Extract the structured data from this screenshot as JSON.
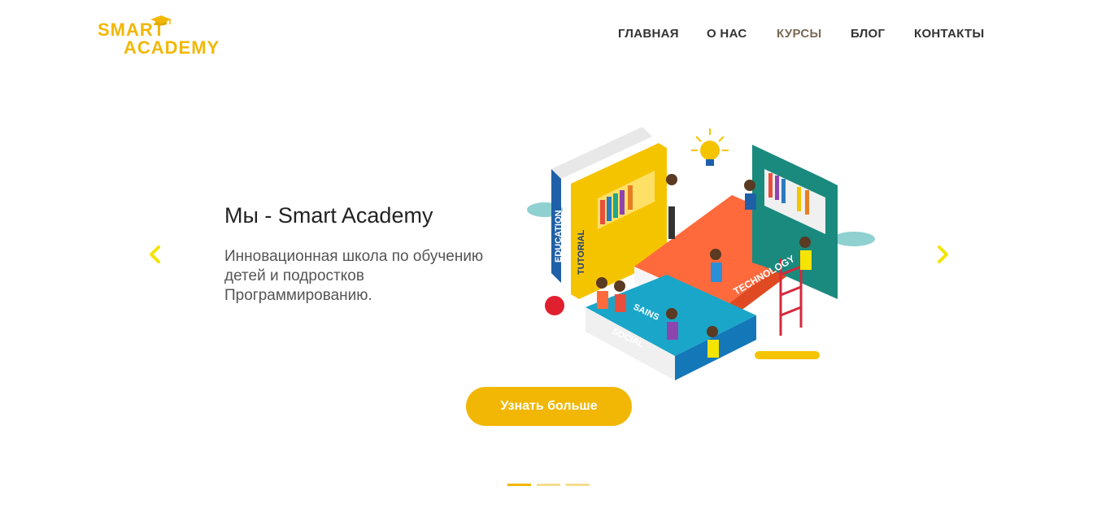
{
  "header": {
    "logo": {
      "line1": "SMART",
      "line2": "ACADEMY",
      "icon": "graduation-cap-icon"
    },
    "nav": [
      {
        "label": "ГЛАВНАЯ",
        "active": false
      },
      {
        "label": "О НАС",
        "active": false
      },
      {
        "label": "КУРСЫ",
        "active": true
      },
      {
        "label": "БЛОГ",
        "active": false
      },
      {
        "label": "КОНТАКТЫ",
        "active": false
      }
    ]
  },
  "hero": {
    "title": "Мы - Smart Academy",
    "subtitle": "Инновационная школа по обучению детей и подростков Программированию.",
    "cta_label": "Узнать больше",
    "prev_icon": "chevron-left-icon",
    "next_icon": "chevron-right-icon",
    "illustration": {
      "book_labels": [
        "EDUCATION",
        "TUTORIAL",
        "TECHNOLOGY",
        "SAINS",
        "SOCIAL"
      ]
    }
  },
  "slider": {
    "slide_count": 3,
    "active_index": 0
  },
  "colors": {
    "accent": "#f2b705",
    "text": "#222222",
    "muted": "#555555",
    "nav_active": "#7a6a55"
  }
}
